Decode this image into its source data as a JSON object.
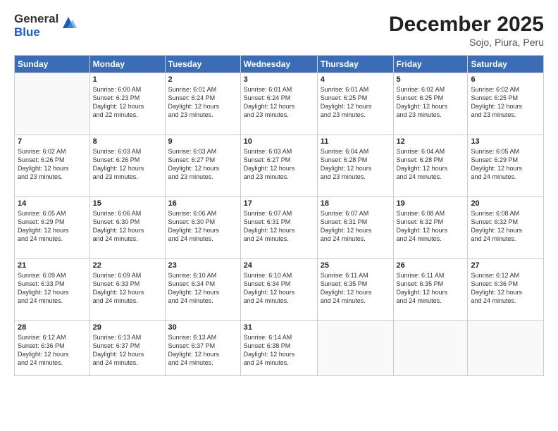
{
  "logo": {
    "general": "General",
    "blue": "Blue"
  },
  "title": "December 2025",
  "location": "Sojo, Piura, Peru",
  "days_of_week": [
    "Sunday",
    "Monday",
    "Tuesday",
    "Wednesday",
    "Thursday",
    "Friday",
    "Saturday"
  ],
  "weeks": [
    [
      {
        "num": "",
        "sunrise": "",
        "sunset": "",
        "daylight": ""
      },
      {
        "num": "1",
        "sunrise": "6:00 AM",
        "sunset": "6:23 PM",
        "daylight": "12 hours and 22 minutes."
      },
      {
        "num": "2",
        "sunrise": "6:01 AM",
        "sunset": "6:24 PM",
        "daylight": "12 hours and 23 minutes."
      },
      {
        "num": "3",
        "sunrise": "6:01 AM",
        "sunset": "6:24 PM",
        "daylight": "12 hours and 23 minutes."
      },
      {
        "num": "4",
        "sunrise": "6:01 AM",
        "sunset": "6:25 PM",
        "daylight": "12 hours and 23 minutes."
      },
      {
        "num": "5",
        "sunrise": "6:02 AM",
        "sunset": "6:25 PM",
        "daylight": "12 hours and 23 minutes."
      },
      {
        "num": "6",
        "sunrise": "6:02 AM",
        "sunset": "6:25 PM",
        "daylight": "12 hours and 23 minutes."
      }
    ],
    [
      {
        "num": "7",
        "sunrise": "6:02 AM",
        "sunset": "6:26 PM",
        "daylight": "12 hours and 23 minutes."
      },
      {
        "num": "8",
        "sunrise": "6:03 AM",
        "sunset": "6:26 PM",
        "daylight": "12 hours and 23 minutes."
      },
      {
        "num": "9",
        "sunrise": "6:03 AM",
        "sunset": "6:27 PM",
        "daylight": "12 hours and 23 minutes."
      },
      {
        "num": "10",
        "sunrise": "6:03 AM",
        "sunset": "6:27 PM",
        "daylight": "12 hours and 23 minutes."
      },
      {
        "num": "11",
        "sunrise": "6:04 AM",
        "sunset": "6:28 PM",
        "daylight": "12 hours and 23 minutes."
      },
      {
        "num": "12",
        "sunrise": "6:04 AM",
        "sunset": "6:28 PM",
        "daylight": "12 hours and 24 minutes."
      },
      {
        "num": "13",
        "sunrise": "6:05 AM",
        "sunset": "6:29 PM",
        "daylight": "12 hours and 24 minutes."
      }
    ],
    [
      {
        "num": "14",
        "sunrise": "6:05 AM",
        "sunset": "6:29 PM",
        "daylight": "12 hours and 24 minutes."
      },
      {
        "num": "15",
        "sunrise": "6:06 AM",
        "sunset": "6:30 PM",
        "daylight": "12 hours and 24 minutes."
      },
      {
        "num": "16",
        "sunrise": "6:06 AM",
        "sunset": "6:30 PM",
        "daylight": "12 hours and 24 minutes."
      },
      {
        "num": "17",
        "sunrise": "6:07 AM",
        "sunset": "6:31 PM",
        "daylight": "12 hours and 24 minutes."
      },
      {
        "num": "18",
        "sunrise": "6:07 AM",
        "sunset": "6:31 PM",
        "daylight": "12 hours and 24 minutes."
      },
      {
        "num": "19",
        "sunrise": "6:08 AM",
        "sunset": "6:32 PM",
        "daylight": "12 hours and 24 minutes."
      },
      {
        "num": "20",
        "sunrise": "6:08 AM",
        "sunset": "6:32 PM",
        "daylight": "12 hours and 24 minutes."
      }
    ],
    [
      {
        "num": "21",
        "sunrise": "6:09 AM",
        "sunset": "6:33 PM",
        "daylight": "12 hours and 24 minutes."
      },
      {
        "num": "22",
        "sunrise": "6:09 AM",
        "sunset": "6:33 PM",
        "daylight": "12 hours and 24 minutes."
      },
      {
        "num": "23",
        "sunrise": "6:10 AM",
        "sunset": "6:34 PM",
        "daylight": "12 hours and 24 minutes."
      },
      {
        "num": "24",
        "sunrise": "6:10 AM",
        "sunset": "6:34 PM",
        "daylight": "12 hours and 24 minutes."
      },
      {
        "num": "25",
        "sunrise": "6:11 AM",
        "sunset": "6:35 PM",
        "daylight": "12 hours and 24 minutes."
      },
      {
        "num": "26",
        "sunrise": "6:11 AM",
        "sunset": "6:35 PM",
        "daylight": "12 hours and 24 minutes."
      },
      {
        "num": "27",
        "sunrise": "6:12 AM",
        "sunset": "6:36 PM",
        "daylight": "12 hours and 24 minutes."
      }
    ],
    [
      {
        "num": "28",
        "sunrise": "6:12 AM",
        "sunset": "6:36 PM",
        "daylight": "12 hours and 24 minutes."
      },
      {
        "num": "29",
        "sunrise": "6:13 AM",
        "sunset": "6:37 PM",
        "daylight": "12 hours and 24 minutes."
      },
      {
        "num": "30",
        "sunrise": "6:13 AM",
        "sunset": "6:37 PM",
        "daylight": "12 hours and 24 minutes."
      },
      {
        "num": "31",
        "sunrise": "6:14 AM",
        "sunset": "6:38 PM",
        "daylight": "12 hours and 24 minutes."
      },
      {
        "num": "",
        "sunrise": "",
        "sunset": "",
        "daylight": ""
      },
      {
        "num": "",
        "sunrise": "",
        "sunset": "",
        "daylight": ""
      },
      {
        "num": "",
        "sunrise": "",
        "sunset": "",
        "daylight": ""
      }
    ]
  ],
  "labels": {
    "sunrise": "Sunrise:",
    "sunset": "Sunset:",
    "daylight": "Daylight:"
  }
}
